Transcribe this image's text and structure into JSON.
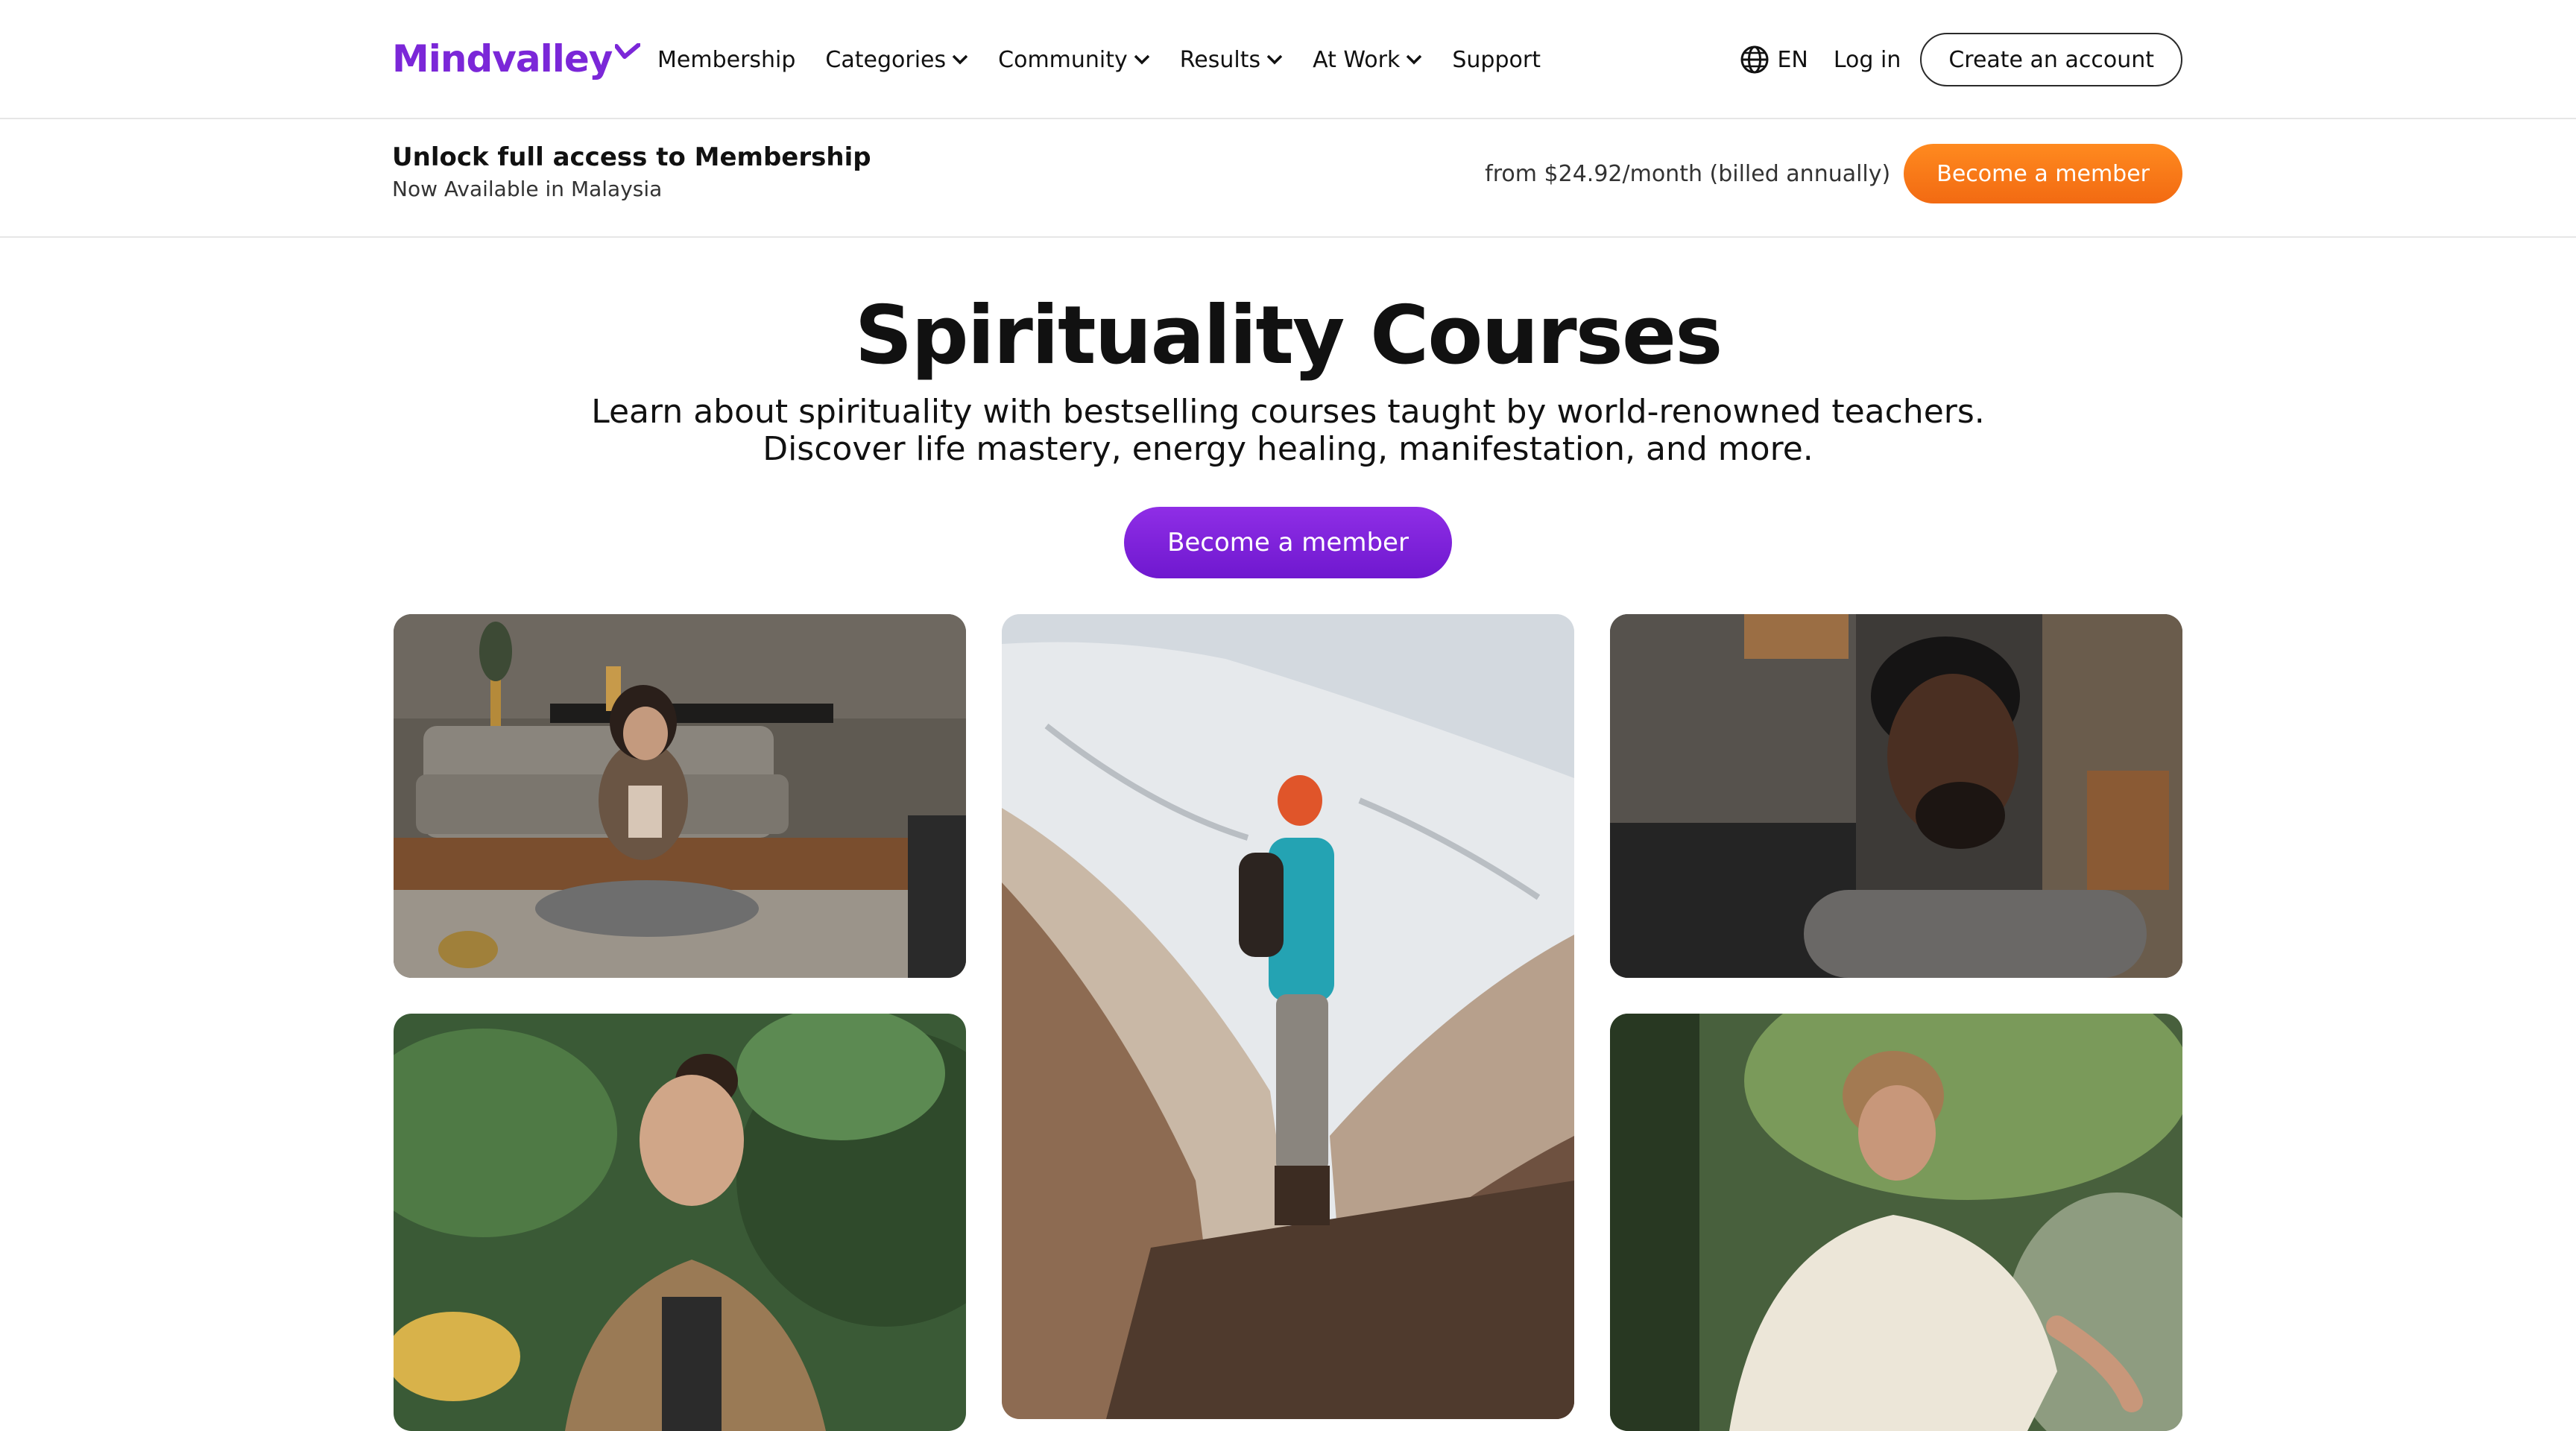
{
  "nav": {
    "logo": "Mindvalley",
    "links": [
      {
        "label": "Membership",
        "dropdown": false
      },
      {
        "label": "Categories",
        "dropdown": true
      },
      {
        "label": "Community",
        "dropdown": true
      },
      {
        "label": "Results",
        "dropdown": true
      },
      {
        "label": "At Work",
        "dropdown": true
      },
      {
        "label": "Support",
        "dropdown": false
      }
    ],
    "language": "EN",
    "login": "Log in",
    "create_account": "Create an account"
  },
  "banner": {
    "title": "Unlock full access to Membership",
    "subtitle": "Now Available in Malaysia",
    "price": "from $24.92/month (billed annually)",
    "cta": "Become a member"
  },
  "hero": {
    "title": "Spirituality Courses",
    "subtitle_line1": "Learn about spirituality with bestselling courses taught by world-renowned teachers.",
    "subtitle_line2": "Discover life mastery, energy healing, manifestation, and more.",
    "cta": "Become a member"
  },
  "colors": {
    "brand_purple": "#7b27d8",
    "orange_cta": "#f47a18",
    "purple_cta": "#7d22dc"
  },
  "gallery": [
    {
      "subject": "woman-meditating-living-room"
    },
    {
      "subject": "hiker-snowy-mountain"
    },
    {
      "subject": "man-eyes-closed-indoors"
    },
    {
      "subject": "woman-in-forest"
    },
    {
      "subject": "man-in-sunlit-forest"
    }
  ]
}
